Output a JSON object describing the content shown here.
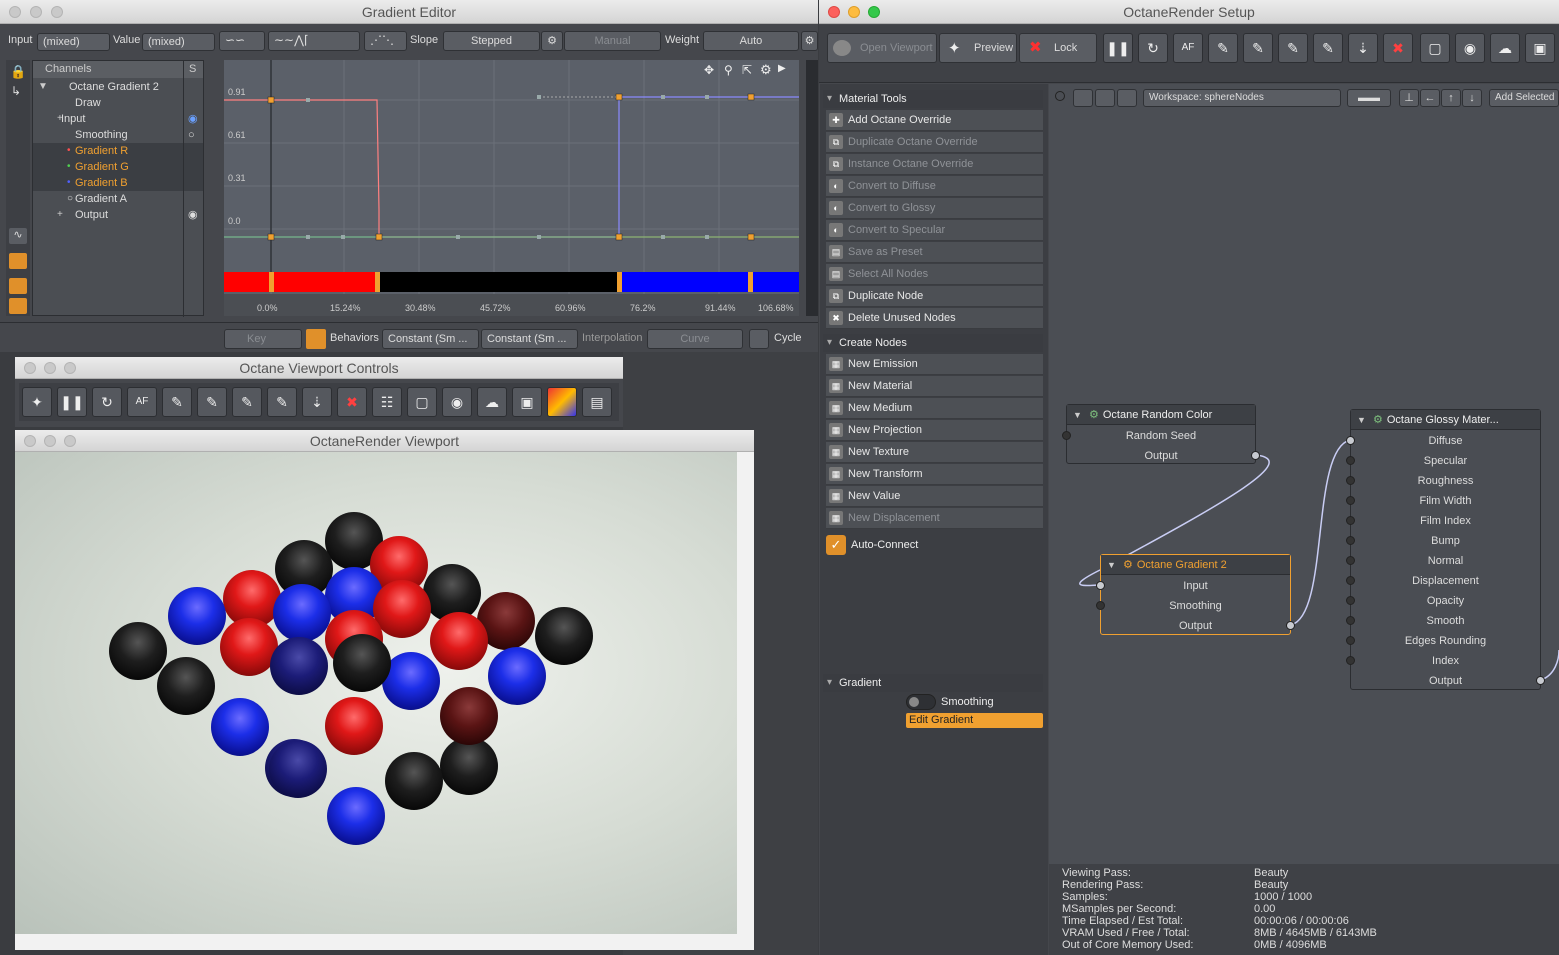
{
  "gradient_editor": {
    "title": "Gradient Editor",
    "input_label": "Input",
    "input_value": "(mixed)",
    "value_label": "Value",
    "value_value": "(mixed)",
    "slope_label": "Slope",
    "slope_value": "Stepped",
    "manual_value": "Manual",
    "weight_label": "Weight",
    "weight_value": "Auto",
    "channels_header": "Channels",
    "s_header": "S",
    "channels": [
      {
        "label": "Octane Gradient 2",
        "color": "#dddddd"
      },
      {
        "label": "Draw",
        "color": "#dddddd"
      },
      {
        "label": "Input",
        "color": "#dddddd"
      },
      {
        "label": "Smoothing",
        "color": "#dddddd"
      },
      {
        "label": "Gradient R",
        "color": "#f0a030"
      },
      {
        "label": "Gradient G",
        "color": "#f0a030"
      },
      {
        "label": "Gradient B",
        "color": "#f0a030"
      },
      {
        "label": "Gradient A",
        "color": "#dddddd"
      },
      {
        "label": "Output",
        "color": "#dddddd"
      }
    ],
    "y_ticks": [
      "0.91",
      "0.61",
      "0.31",
      "0.0"
    ],
    "x_ticks": [
      "0.0%",
      "15.24%",
      "30.48%",
      "45.72%",
      "60.96%",
      "76.2%",
      "91.44%",
      "106.68%"
    ],
    "key_label": "Key",
    "behaviors_label": "Behaviors",
    "behavior_1": "Constant (Sm ...",
    "behavior_2": "Constant (Sm ...",
    "interpolation_label": "Interpolation",
    "interpolation_value": "Curve",
    "cycle_label": "Cycle"
  },
  "viewport_controls": {
    "title": "Octane Viewport Controls"
  },
  "render_viewport": {
    "title": "OctaneRender Viewport",
    "spheres": [
      "black",
      "black",
      "red",
      "red",
      "black",
      "blue",
      "black",
      "blue",
      "blue",
      "red",
      "red",
      "dark",
      "black",
      "red",
      "red",
      "black",
      "black",
      "black",
      "navy",
      "blue",
      "blue",
      "blue",
      "navy",
      "red",
      "dark",
      "navy",
      "black",
      "blue"
    ]
  },
  "setup": {
    "title": "OctaneRender Setup",
    "open_viewport": "Open Viewport",
    "preview": "Preview",
    "lock": "Lock",
    "material_tools_header": "Material Tools",
    "material_tools": [
      {
        "label": "Add Octane Override",
        "enabled": true
      },
      {
        "label": "Duplicate Octane Override",
        "enabled": false
      },
      {
        "label": "Instance Octane Override",
        "enabled": false
      },
      {
        "label": "Convert to Diffuse",
        "enabled": false
      },
      {
        "label": "Convert to Glossy",
        "enabled": false
      },
      {
        "label": "Convert to Specular",
        "enabled": false
      },
      {
        "label": "Save as Preset",
        "enabled": false
      },
      {
        "label": "Select All Nodes",
        "enabled": false
      },
      {
        "label": "Duplicate Node",
        "enabled": true
      },
      {
        "label": "Delete Unused Nodes",
        "enabled": true
      }
    ],
    "create_nodes_header": "Create Nodes",
    "create_nodes": [
      {
        "label": "New Emission",
        "enabled": true
      },
      {
        "label": "New Material",
        "enabled": true
      },
      {
        "label": "New Medium",
        "enabled": true
      },
      {
        "label": "New Projection",
        "enabled": true
      },
      {
        "label": "New Texture",
        "enabled": true
      },
      {
        "label": "New Transform",
        "enabled": true
      },
      {
        "label": "New Value",
        "enabled": true
      },
      {
        "label": "New Displacement",
        "enabled": false
      }
    ],
    "auto_connect": "Auto-Connect",
    "gradient_header": "Gradient",
    "smoothing": "Smoothing",
    "edit_gradient": "Edit Gradient",
    "workspace": "Workspace: sphereNodes",
    "add_selected": "Add Selected",
    "node_random": {
      "title": "Octane Random Color",
      "ports": [
        "Random Seed",
        "Output"
      ]
    },
    "node_gradient": {
      "title": "Octane Gradient 2",
      "ports": [
        "Input",
        "Smoothing",
        "Output"
      ]
    },
    "node_glossy": {
      "title": "Octane Glossy Mater...",
      "ports": [
        "Diffuse",
        "Specular",
        "Roughness",
        "Film Width",
        "Film Index",
        "Bump",
        "Normal",
        "Displacement",
        "Opacity",
        "Smooth",
        "Edges Rounding",
        "Index",
        "Output"
      ]
    },
    "stats": [
      {
        "label": "Viewing Pass:",
        "value": "Beauty"
      },
      {
        "label": "Rendering Pass:",
        "value": "Beauty"
      },
      {
        "label": "Samples:",
        "value": "1000  / 1000"
      },
      {
        "label": "MSamples per Second:",
        "value": "0.00"
      },
      {
        "label": "Time Elapsed / Est Total:",
        "value": "00:00:06 / 00:00:06"
      },
      {
        "label": "VRAM Used / Free / Total:",
        "value": "8MB / 4645MB / 6143MB"
      },
      {
        "label": "Out of Core Memory Used:",
        "value": "0MB / 4096MB"
      }
    ]
  }
}
